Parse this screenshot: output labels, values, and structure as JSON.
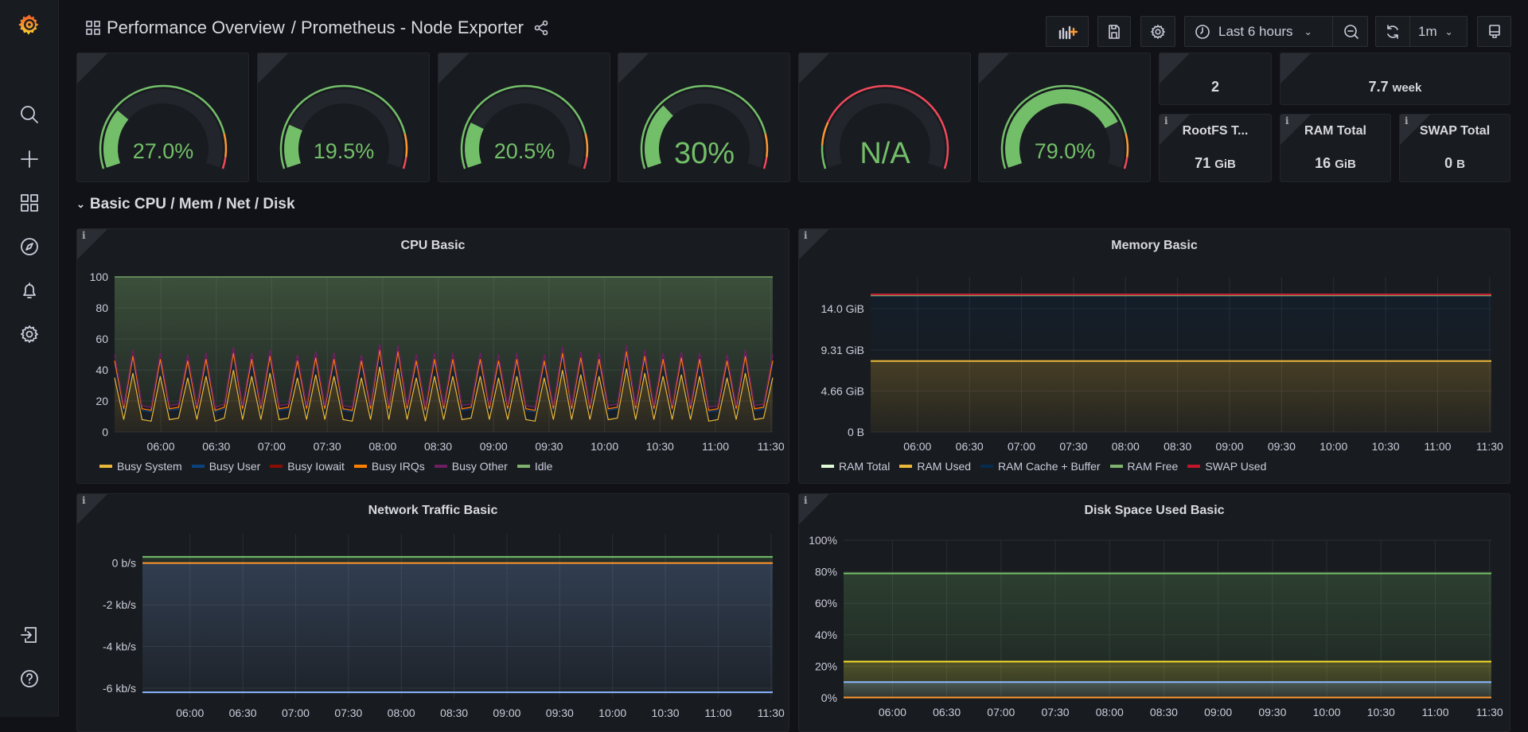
{
  "header": {
    "title": "Performance Overview",
    "subtitle": "/ Prometheus - Node Exporter",
    "time_range": "Last 6 hours",
    "refresh": "1m"
  },
  "sidebar": {
    "items": [
      "grafana-logo",
      "search",
      "create",
      "dashboards",
      "explore",
      "alerting",
      "configuration",
      "sign-in",
      "help"
    ]
  },
  "colors": {
    "green": "#73bf69",
    "orange": "#ff9830",
    "red": "#f2495c",
    "gauge_bg": "#22252b"
  },
  "gauges": [
    {
      "value": 27.0,
      "display": "27.0%",
      "thresholds": [
        [
          0,
          "green"
        ],
        [
          85,
          "orange"
        ],
        [
          95,
          "red"
        ]
      ]
    },
    {
      "value": 19.5,
      "display": "19.5%",
      "thresholds": [
        [
          0,
          "green"
        ],
        [
          85,
          "orange"
        ],
        [
          95,
          "red"
        ]
      ]
    },
    {
      "value": 20.5,
      "display": "20.5%",
      "thresholds": [
        [
          0,
          "green"
        ],
        [
          85,
          "orange"
        ],
        [
          95,
          "red"
        ]
      ]
    },
    {
      "value": 30,
      "display": "30%",
      "thresholds": [
        [
          0,
          "green"
        ],
        [
          85,
          "orange"
        ],
        [
          95,
          "red"
        ]
      ]
    },
    {
      "value": null,
      "display": "N/A",
      "thresholds": [
        [
          0,
          "green"
        ],
        [
          10,
          "orange"
        ],
        [
          20,
          "red"
        ]
      ]
    },
    {
      "value": 79.0,
      "display": "79.0%",
      "thresholds": [
        [
          0,
          "green"
        ],
        [
          85,
          "orange"
        ],
        [
          95,
          "red"
        ]
      ]
    }
  ],
  "stats": [
    {
      "title": "",
      "value": "2",
      "unit": ""
    },
    {
      "title": "",
      "value": "7.7",
      "unit": "week"
    },
    {
      "title": "RootFS T...",
      "value": "71",
      "unit": "GiB"
    },
    {
      "title": "RAM Total",
      "value": "16",
      "unit": "GiB"
    },
    {
      "title": "SWAP Total",
      "value": "0",
      "unit": "B"
    }
  ],
  "section": {
    "title": "Basic CPU / Mem / Net / Disk"
  },
  "chart_data": [
    {
      "type": "area",
      "title": "CPU Basic",
      "stacked": true,
      "time_range": [
        "05:35",
        "11:31"
      ],
      "xticks": [
        "06:00",
        "06:30",
        "07:00",
        "07:30",
        "08:00",
        "08:30",
        "09:00",
        "09:30",
        "10:00",
        "10:30",
        "11:00",
        "11:30"
      ],
      "ylim": [
        0,
        100
      ],
      "yticks": [
        "0",
        "20",
        "40",
        "60",
        "80",
        "100"
      ],
      "grid": true,
      "legend": "bottom",
      "series": [
        {
          "name": "Busy System",
          "color": "#EAB839",
          "values": [
            35,
            8,
            38,
            8,
            7,
            36,
            8,
            9,
            35,
            8,
            36,
            7,
            9,
            40,
            8,
            36,
            8,
            38,
            8,
            9,
            35,
            8,
            37,
            8,
            36,
            8,
            7,
            35,
            8,
            42,
            8,
            41,
            8,
            35,
            7,
            36,
            8,
            36,
            8,
            9,
            36,
            8,
            35,
            8,
            36,
            8,
            7,
            35,
            8,
            40,
            8,
            37,
            8,
            36,
            8,
            9,
            41,
            8,
            38,
            8,
            36,
            8,
            37,
            8,
            36,
            7,
            8,
            35,
            8,
            38,
            8,
            9,
            35
          ]
        },
        {
          "name": "Busy User",
          "color": "#0A437C",
          "values": [
            10,
            6,
            10,
            6,
            6,
            10,
            6,
            6,
            10,
            6,
            10,
            6,
            6,
            10,
            6,
            10,
            6,
            10,
            6,
            6,
            10,
            6,
            10,
            6,
            10,
            6,
            6,
            10,
            6,
            10,
            6,
            10,
            6,
            10,
            6,
            10,
            6,
            10,
            6,
            6,
            10,
            6,
            10,
            6,
            10,
            6,
            6,
            10,
            6,
            10,
            6,
            10,
            6,
            10,
            6,
            6,
            10,
            6,
            10,
            6,
            10,
            6,
            10,
            6,
            10,
            6,
            6,
            10,
            6,
            10,
            6,
            6,
            10
          ]
        },
        {
          "name": "Busy Iowait",
          "color": "#890F02",
          "values": [
            1,
            1,
            1,
            1,
            1,
            1,
            1,
            1,
            1,
            1,
            1,
            1,
            1,
            1,
            1,
            1,
            1,
            1,
            1,
            1,
            1,
            1,
            1,
            1,
            1,
            1,
            1,
            1,
            1,
            1,
            1,
            1,
            1,
            1,
            1,
            1,
            1,
            1,
            1,
            1,
            1,
            1,
            1,
            1,
            1,
            1,
            1,
            1,
            1,
            1,
            1,
            1,
            1,
            1,
            1,
            1,
            1,
            1,
            1,
            1,
            1,
            1,
            1,
            1,
            1,
            1,
            1,
            1,
            1,
            1,
            1,
            1,
            1
          ]
        },
        {
          "name": "Busy IRQs",
          "color": "#FF7F00",
          "values": [
            0,
            0,
            0,
            0,
            0,
            0,
            0,
            0,
            0,
            0,
            0,
            0,
            0,
            0,
            0,
            0,
            0,
            0,
            0,
            0,
            0,
            0,
            0,
            0,
            0,
            0,
            0,
            0,
            0,
            0,
            0,
            0,
            0,
            0,
            0,
            0,
            0,
            0,
            0,
            0,
            0,
            0,
            0,
            0,
            0,
            0,
            0,
            0,
            0,
            0,
            0,
            0,
            0,
            0,
            0,
            0,
            0,
            0,
            0,
            0,
            0,
            0,
            0,
            0,
            0,
            0,
            0,
            0,
            0,
            0,
            0,
            0,
            0
          ]
        },
        {
          "name": "Busy Other",
          "color": "#6D1F62",
          "values": [
            4,
            2,
            4,
            2,
            2,
            4,
            2,
            2,
            4,
            2,
            4,
            2,
            2,
            4,
            2,
            4,
            2,
            4,
            2,
            2,
            4,
            2,
            4,
            2,
            4,
            2,
            2,
            4,
            2,
            4,
            2,
            4,
            2,
            4,
            2,
            4,
            2,
            4,
            2,
            2,
            4,
            2,
            4,
            2,
            4,
            2,
            2,
            4,
            2,
            4,
            2,
            4,
            2,
            4,
            2,
            2,
            4,
            2,
            4,
            2,
            4,
            2,
            4,
            2,
            4,
            2,
            2,
            4,
            2,
            4,
            2,
            2,
            4
          ]
        },
        {
          "name": "Idle",
          "color": "#7EB26D",
          "values": null
        }
      ]
    },
    {
      "type": "area",
      "title": "Memory Basic",
      "unit": "GiB",
      "time_range": [
        "05:33",
        "11:31"
      ],
      "xticks": [
        "06:00",
        "06:30",
        "07:00",
        "07:30",
        "08:00",
        "08:30",
        "09:00",
        "09:30",
        "10:00",
        "10:30",
        "11:00",
        "11:30"
      ],
      "ylim": [
        0,
        17.6
      ],
      "yticks": [
        [
          0,
          "0 B"
        ],
        [
          4.66,
          "4.66 GiB"
        ],
        [
          9.31,
          "9.31 GiB"
        ],
        [
          14.0,
          "14.0 GiB"
        ]
      ],
      "grid": true,
      "legend": "bottom",
      "series": [
        {
          "name": "RAM Total",
          "color": "#E0F9D7",
          "value": 15.6,
          "fill": false
        },
        {
          "name": "RAM Used",
          "color": "#EAB839",
          "value": 8.05,
          "fill": true,
          "base": 0
        },
        {
          "name": "RAM Cache + Buffer",
          "color": "#052B51",
          "value": 15.45,
          "fill": true,
          "base": 8.05
        },
        {
          "name": "RAM Free",
          "color": "#7EB26D",
          "value": 15.5,
          "fill": false
        },
        {
          "name": "SWAP Used",
          "color": "#C4162A",
          "value": 15.6,
          "fill": false
        }
      ]
    },
    {
      "type": "area",
      "title": "Network Traffic Basic",
      "unit": "kb/s",
      "time_range": [
        "05:33",
        "11:31"
      ],
      "xticks": [
        "06:00",
        "06:30",
        "07:00",
        "07:30",
        "08:00",
        "08:30",
        "09:00",
        "09:30",
        "10:00",
        "10:30",
        "11:00",
        "11:30"
      ],
      "ylim": [
        -6.5,
        1.4
      ],
      "yticks": [
        [
          0,
          "0 b/s"
        ],
        [
          -2,
          "-2 kb/s"
        ],
        [
          -4,
          "-4 kb/s"
        ],
        [
          -6,
          "-6 kb/s"
        ]
      ],
      "grid": true,
      "series": [
        {
          "color": "#73BF69",
          "value": 0.3,
          "fill": true,
          "base": 0
        },
        {
          "color": "#FF9830",
          "value": 0,
          "fill": false
        },
        {
          "color": "#8AB8FF",
          "value": -6.2,
          "fill": true,
          "base": 0
        }
      ]
    },
    {
      "type": "area",
      "title": "Disk Space Used Basic",
      "unit": "%",
      "time_range": [
        "05:33",
        "11:31"
      ],
      "xticks": [
        "06:00",
        "06:30",
        "07:00",
        "07:30",
        "08:00",
        "08:30",
        "09:00",
        "09:30",
        "10:00",
        "10:30",
        "11:00",
        "11:30"
      ],
      "ylim": [
        0,
        100
      ],
      "yticks": [
        [
          0,
          "0%"
        ],
        [
          20,
          "20%"
        ],
        [
          40,
          "40%"
        ],
        [
          60,
          "60%"
        ],
        [
          80,
          "80%"
        ],
        [
          100,
          "100%"
        ]
      ],
      "grid": true,
      "series": [
        {
          "color": "#73BF69",
          "value": 79,
          "fill": true,
          "base": 0
        },
        {
          "color": "#FADE2A",
          "value": 23,
          "fill": true,
          "base": 0
        },
        {
          "color": "#8AB8FF",
          "value": 10,
          "fill": true,
          "base": 0
        },
        {
          "color": "#FF9830",
          "value": 0.2,
          "fill": false
        }
      ]
    }
  ]
}
